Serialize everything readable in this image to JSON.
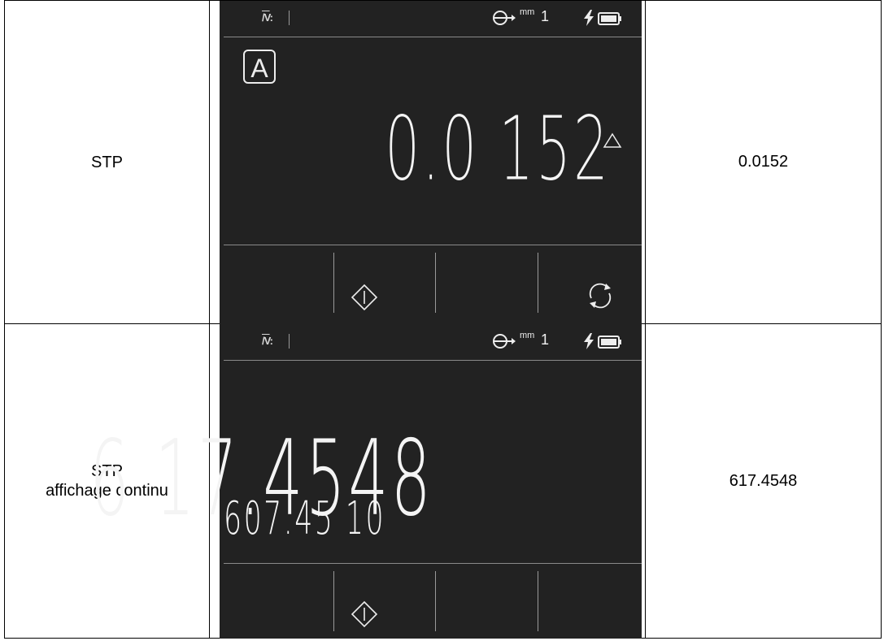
{
  "rows": [
    {
      "label_line1": "STP",
      "label_line2": "",
      "value": "0.0152",
      "screen": {
        "mode_icon": "filter-mode-icon",
        "unit": "mm",
        "channel": "1",
        "power_icons": [
          "charging-bolt-icon",
          "battery-full-icon"
        ],
        "reference_box": "A",
        "main_reading": "0.0 152",
        "indicator": "△",
        "softkeys": [
          "",
          "start-icon",
          "",
          "refresh-icon"
        ]
      }
    },
    {
      "label_line1": "STP",
      "label_line2": "affichage continu",
      "value": "617.4548",
      "screen": {
        "mode_icon": "filter-mode-icon",
        "unit": "mm",
        "channel": "1",
        "power_icons": [
          "charging-bolt-icon",
          "battery-full-icon"
        ],
        "main_reading": "6 17.4548",
        "secondary_reading": "607.45 10",
        "softkeys": [
          "",
          "start-icon",
          "",
          ""
        ]
      }
    }
  ],
  "colors": {
    "screen_bg": "#222222",
    "screen_fg": "#f2f2f2",
    "divider": "#8a8a8a"
  }
}
